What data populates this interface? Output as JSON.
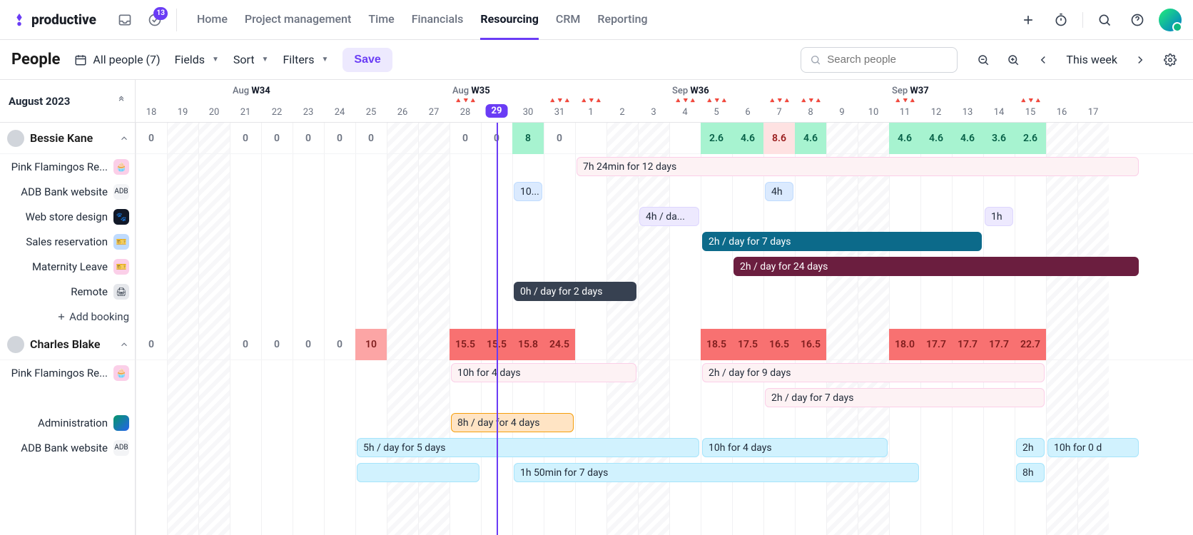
{
  "brand": "productive",
  "inbox_badge": "13",
  "nav": [
    {
      "label": "Home"
    },
    {
      "label": "Project management"
    },
    {
      "label": "Time"
    },
    {
      "label": "Financials"
    },
    {
      "label": "Resourcing",
      "active": true
    },
    {
      "label": "CRM"
    },
    {
      "label": "Reporting"
    }
  ],
  "page_title": "People",
  "filters": {
    "people_filter": "All people (7)",
    "fields": "Fields",
    "sort": "Sort",
    "filters": "Filters",
    "save": "Save"
  },
  "search_placeholder": "Search people",
  "this_week": "This week",
  "month_header": "August 2023",
  "week_labels": [
    {
      "text_a": "Aug",
      "text_b": "W34",
      "col": 3
    },
    {
      "text_a": "Aug",
      "text_b": "W35",
      "col": 10
    },
    {
      "text_a": "Sep",
      "text_b": "W36",
      "col": 17
    },
    {
      "text_a": "Sep",
      "text_b": "W37",
      "col": 24
    }
  ],
  "days": [
    {
      "n": 18,
      "weekend": false
    },
    {
      "n": 19,
      "weekend": true
    },
    {
      "n": 20,
      "weekend": true
    },
    {
      "n": 21,
      "weekend": false
    },
    {
      "n": 22,
      "weekend": false
    },
    {
      "n": 23,
      "weekend": false
    },
    {
      "n": 24,
      "weekend": false
    },
    {
      "n": 25,
      "weekend": false
    },
    {
      "n": 26,
      "weekend": true
    },
    {
      "n": 27,
      "weekend": true
    },
    {
      "n": 28,
      "weekend": false
    },
    {
      "n": 29,
      "weekend": false,
      "today": true
    },
    {
      "n": 30,
      "weekend": false
    },
    {
      "n": 31,
      "weekend": false
    },
    {
      "n": 1,
      "weekend": false
    },
    {
      "n": 2,
      "weekend": true
    },
    {
      "n": 3,
      "weekend": true
    },
    {
      "n": 4,
      "weekend": false
    },
    {
      "n": 5,
      "weekend": false
    },
    {
      "n": 6,
      "weekend": false
    },
    {
      "n": 7,
      "weekend": false
    },
    {
      "n": 8,
      "weekend": false
    },
    {
      "n": 9,
      "weekend": true
    },
    {
      "n": 10,
      "weekend": true
    },
    {
      "n": 11,
      "weekend": false
    },
    {
      "n": 12,
      "weekend": false
    },
    {
      "n": 13,
      "weekend": false
    },
    {
      "n": 14,
      "weekend": false
    },
    {
      "n": 15,
      "weekend": false
    },
    {
      "n": 16,
      "weekend": true
    },
    {
      "n": 17,
      "weekend": true
    }
  ],
  "flag_cols": [
    10,
    13,
    14,
    17,
    18,
    20,
    21,
    24,
    28
  ],
  "people": [
    {
      "name": "Bessie Kane",
      "totals": [
        {
          "col": 0,
          "val": "0",
          "cls": "zero"
        },
        {
          "col": 3,
          "val": "0",
          "cls": "zero"
        },
        {
          "col": 4,
          "val": "0",
          "cls": "zero"
        },
        {
          "col": 5,
          "val": "0",
          "cls": "zero"
        },
        {
          "col": 6,
          "val": "0",
          "cls": "zero"
        },
        {
          "col": 7,
          "val": "0",
          "cls": "zero"
        },
        {
          "col": 10,
          "val": "0",
          "cls": "zero"
        },
        {
          "col": 11,
          "val": "0",
          "cls": "zero"
        },
        {
          "col": 12,
          "val": "8",
          "cls": "green"
        },
        {
          "col": 13,
          "val": "0",
          "cls": "zero"
        },
        {
          "col": 18,
          "val": "2.6",
          "cls": "green"
        },
        {
          "col": 19,
          "val": "4.6",
          "cls": "green"
        },
        {
          "col": 20,
          "val": "8.6",
          "cls": "redlight"
        },
        {
          "col": 21,
          "val": "4.6",
          "cls": "green"
        },
        {
          "col": 24,
          "val": "4.6",
          "cls": "green"
        },
        {
          "col": 25,
          "val": "4.6",
          "cls": "green"
        },
        {
          "col": 26,
          "val": "4.6",
          "cls": "green"
        },
        {
          "col": 27,
          "val": "3.6",
          "cls": "green"
        },
        {
          "col": 28,
          "val": "2.6",
          "cls": "green"
        }
      ],
      "tasks": [
        {
          "label": "Pink Flamingos Re...",
          "icon": "pink",
          "glyph": "🧁",
          "bars": [
            {
              "start": 14,
              "span": 18,
              "cls": "pink",
              "text": "7h 24min for 12 days"
            }
          ]
        },
        {
          "label": "ADB Bank website",
          "icon": "gray",
          "glyph": "ADB",
          "bars": [
            {
              "start": 12,
              "span": 1,
              "cls": "blue",
              "text": "10..."
            },
            {
              "start": 20,
              "span": 1,
              "cls": "blue",
              "text": "4h"
            }
          ]
        },
        {
          "label": "Web store design",
          "icon": "dark",
          "glyph": "🐾",
          "bars": [
            {
              "start": 16,
              "span": 2,
              "cls": "lav",
              "text": "4h / da..."
            },
            {
              "start": 27,
              "span": 1,
              "cls": "lav",
              "text": "1h"
            }
          ]
        },
        {
          "label": "Sales reservation",
          "icon": "blue",
          "glyph": "🎫",
          "bars": [
            {
              "start": 18,
              "span": 9,
              "cls": "teal",
              "text": "2h / day for 7 days"
            }
          ]
        },
        {
          "label": "Maternity Leave",
          "icon": "pink2",
          "glyph": "🎫",
          "bars": [
            {
              "start": 19,
              "span": 13,
              "cls": "wine",
              "text": "2h / day for 24 days"
            }
          ]
        },
        {
          "label": "Remote",
          "icon": "gray2",
          "glyph": "🖨",
          "bars": [
            {
              "start": 12,
              "span": 4,
              "cls": "dark",
              "text": "0h / day for 2 days"
            }
          ]
        }
      ],
      "add_booking_label": "Add booking"
    },
    {
      "name": "Charles Blake",
      "totals": [
        {
          "col": 0,
          "val": "0",
          "cls": "zero"
        },
        {
          "col": 3,
          "val": "0",
          "cls": "zero"
        },
        {
          "col": 4,
          "val": "0",
          "cls": "zero"
        },
        {
          "col": 5,
          "val": "0",
          "cls": "zero"
        },
        {
          "col": 6,
          "val": "0",
          "cls": "zero"
        },
        {
          "col": 7,
          "val": "10",
          "cls": "red"
        },
        {
          "col": 10,
          "val": "15.5",
          "cls": "redstrong"
        },
        {
          "col": 11,
          "val": "15.5",
          "cls": "redstrong"
        },
        {
          "col": 12,
          "val": "15.8",
          "cls": "redstrong"
        },
        {
          "col": 13,
          "val": "24.5",
          "cls": "redstrong"
        },
        {
          "col": 18,
          "val": "18.5",
          "cls": "redstrong"
        },
        {
          "col": 19,
          "val": "17.5",
          "cls": "redstrong"
        },
        {
          "col": 20,
          "val": "16.5",
          "cls": "redstrong"
        },
        {
          "col": 21,
          "val": "16.5",
          "cls": "redstrong"
        },
        {
          "col": 24,
          "val": "18.0",
          "cls": "redstrong"
        },
        {
          "col": 25,
          "val": "17.7",
          "cls": "redstrong"
        },
        {
          "col": 26,
          "val": "17.7",
          "cls": "redstrong"
        },
        {
          "col": 27,
          "val": "17.7",
          "cls": "redstrong"
        },
        {
          "col": 28,
          "val": "22.7",
          "cls": "redstrong"
        }
      ],
      "tasks": [
        {
          "label": "Pink Flamingos Re...",
          "icon": "pink",
          "glyph": "🧁",
          "bars": [
            {
              "start": 10,
              "span": 6,
              "cls": "pink",
              "text": "10h for 4 days"
            },
            {
              "start": 18,
              "span": 11,
              "cls": "pink",
              "text": "2h / day for 9 days"
            }
          ]
        },
        {
          "label": "",
          "icon": "",
          "bars": [
            {
              "start": 20,
              "span": 9,
              "cls": "pink",
              "text": "2h / day for 7 days"
            }
          ]
        },
        {
          "label": "Administration",
          "icon": "green",
          "glyph": "",
          "bars": [
            {
              "start": 10,
              "span": 4,
              "cls": "orange",
              "text": "8h / day for 4 days"
            }
          ]
        },
        {
          "label": "ADB Bank website",
          "icon": "gray",
          "glyph": "ADB",
          "bars": [
            {
              "start": 7,
              "span": 11,
              "cls": "cyan",
              "text": "5h / day for 5 days"
            },
            {
              "start": 18,
              "span": 6,
              "cls": "cyan",
              "text": "10h for 4 days"
            },
            {
              "start": 28,
              "span": 1,
              "cls": "cyan",
              "text": "2h"
            },
            {
              "start": 29,
              "span": 3,
              "cls": "cyan",
              "text": "10h for 0 d"
            }
          ]
        },
        {
          "label": "",
          "icon": "",
          "bars": [
            {
              "start": 7,
              "span": 4,
              "cls": "cyan",
              "text": ""
            },
            {
              "start": 12,
              "span": 13,
              "cls": "cyan",
              "text": "1h 50min for 7 days"
            },
            {
              "start": 28,
              "span": 1,
              "cls": "cyan",
              "text": "8h"
            }
          ]
        }
      ]
    }
  ]
}
